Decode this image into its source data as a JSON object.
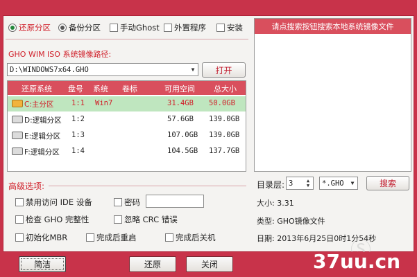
{
  "options": {
    "restore": "还原分区",
    "backup": "备份分区",
    "manual_ghost": "手动Ghost",
    "external": "外置程序",
    "install": "安装"
  },
  "path_label": "GHO WIM ISO 系统镜像路径:",
  "path_value": "D:\\WINDOWS7x64.GHO",
  "open_button": "打开",
  "table": {
    "headers": [
      "还原系统",
      "盘号",
      "系统",
      "卷标",
      "可用空间",
      "总大小"
    ],
    "rows": [
      {
        "name": "C:主分区",
        "disk": "1:1",
        "os": "Win7",
        "label": "",
        "free": "31.4GB",
        "total": "50.0GB"
      },
      {
        "name": "D:逻辑分区",
        "disk": "1:2",
        "os": "",
        "label": "",
        "free": "57.6GB",
        "total": "139.0GB"
      },
      {
        "name": "E:逻辑分区",
        "disk": "1:3",
        "os": "",
        "label": "",
        "free": "107.0GB",
        "total": "139.0GB"
      },
      {
        "name": "F:逻辑分区",
        "disk": "1:4",
        "os": "",
        "label": "",
        "free": "104.5GB",
        "total": "137.7GB"
      }
    ]
  },
  "right_panel_header": "请点搜索按钮搜索本地系统镜像文件",
  "depth_label": "目录层:",
  "depth_value": "3",
  "ext_value": "*.GHO",
  "search_button": "搜索",
  "size_text": "大小: 3.31",
  "type_text": "类型: GHO镜像文件",
  "date_text": "日期: 2013年6月25日0时1分54秒",
  "advanced_label": "高级选项:",
  "adv": {
    "disable_ide": "禁用访问 IDE 设备",
    "password": "密码",
    "check_gho": "检查 GHO 完整性",
    "ignore_crc": "忽略 CRC 错误",
    "init_mbr": "初始化MBR",
    "reboot": "完成后重启",
    "shutdown": "完成后关机"
  },
  "bottom": {
    "simple": "简洁",
    "restore": "还原",
    "close": "关闭"
  },
  "watermark": "37uu.cn",
  "colors": {
    "accent": "#c8334a",
    "header": "#d94f5d",
    "selected_row": "#bfe6bf"
  }
}
